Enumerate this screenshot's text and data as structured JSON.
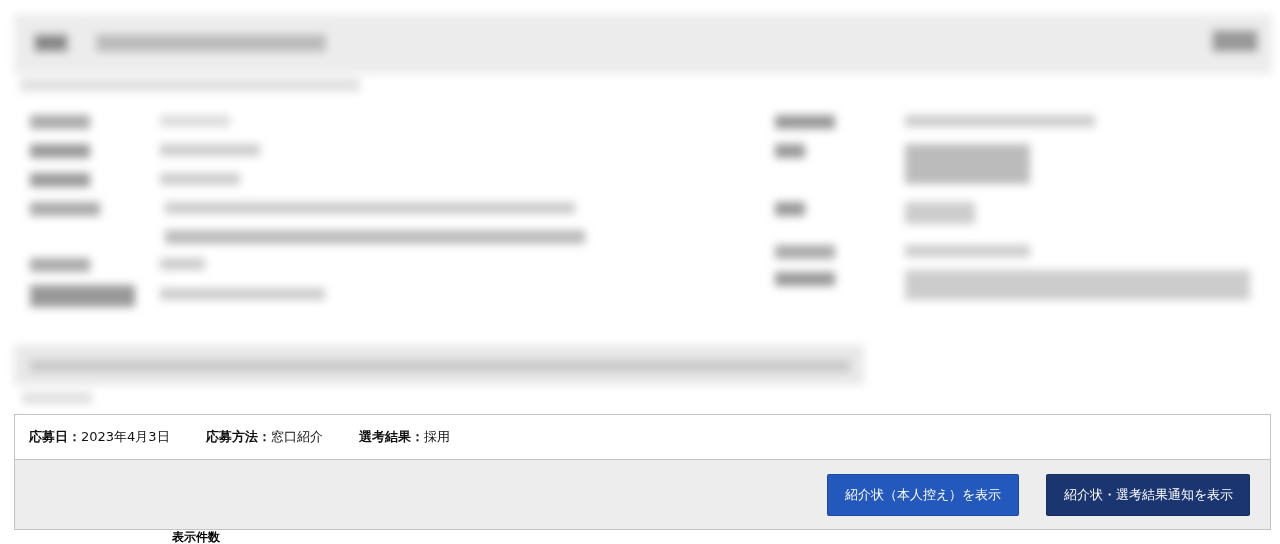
{
  "blurred_area": {
    "kind": "blurred"
  },
  "application": {
    "fields": [
      {
        "label": "応募日：",
        "value": "2023年4月3日"
      },
      {
        "label": "応募方法：",
        "value": "窓口紹介"
      },
      {
        "label": "選考結果：",
        "value": "採用"
      }
    ],
    "buttons": [
      {
        "label": "紹介状（本人控え）を表示",
        "kind": "primary"
      },
      {
        "label": "紹介状・選考結果通知を表示",
        "kind": "dark"
      }
    ]
  },
  "footer_heading": "表示件数"
}
